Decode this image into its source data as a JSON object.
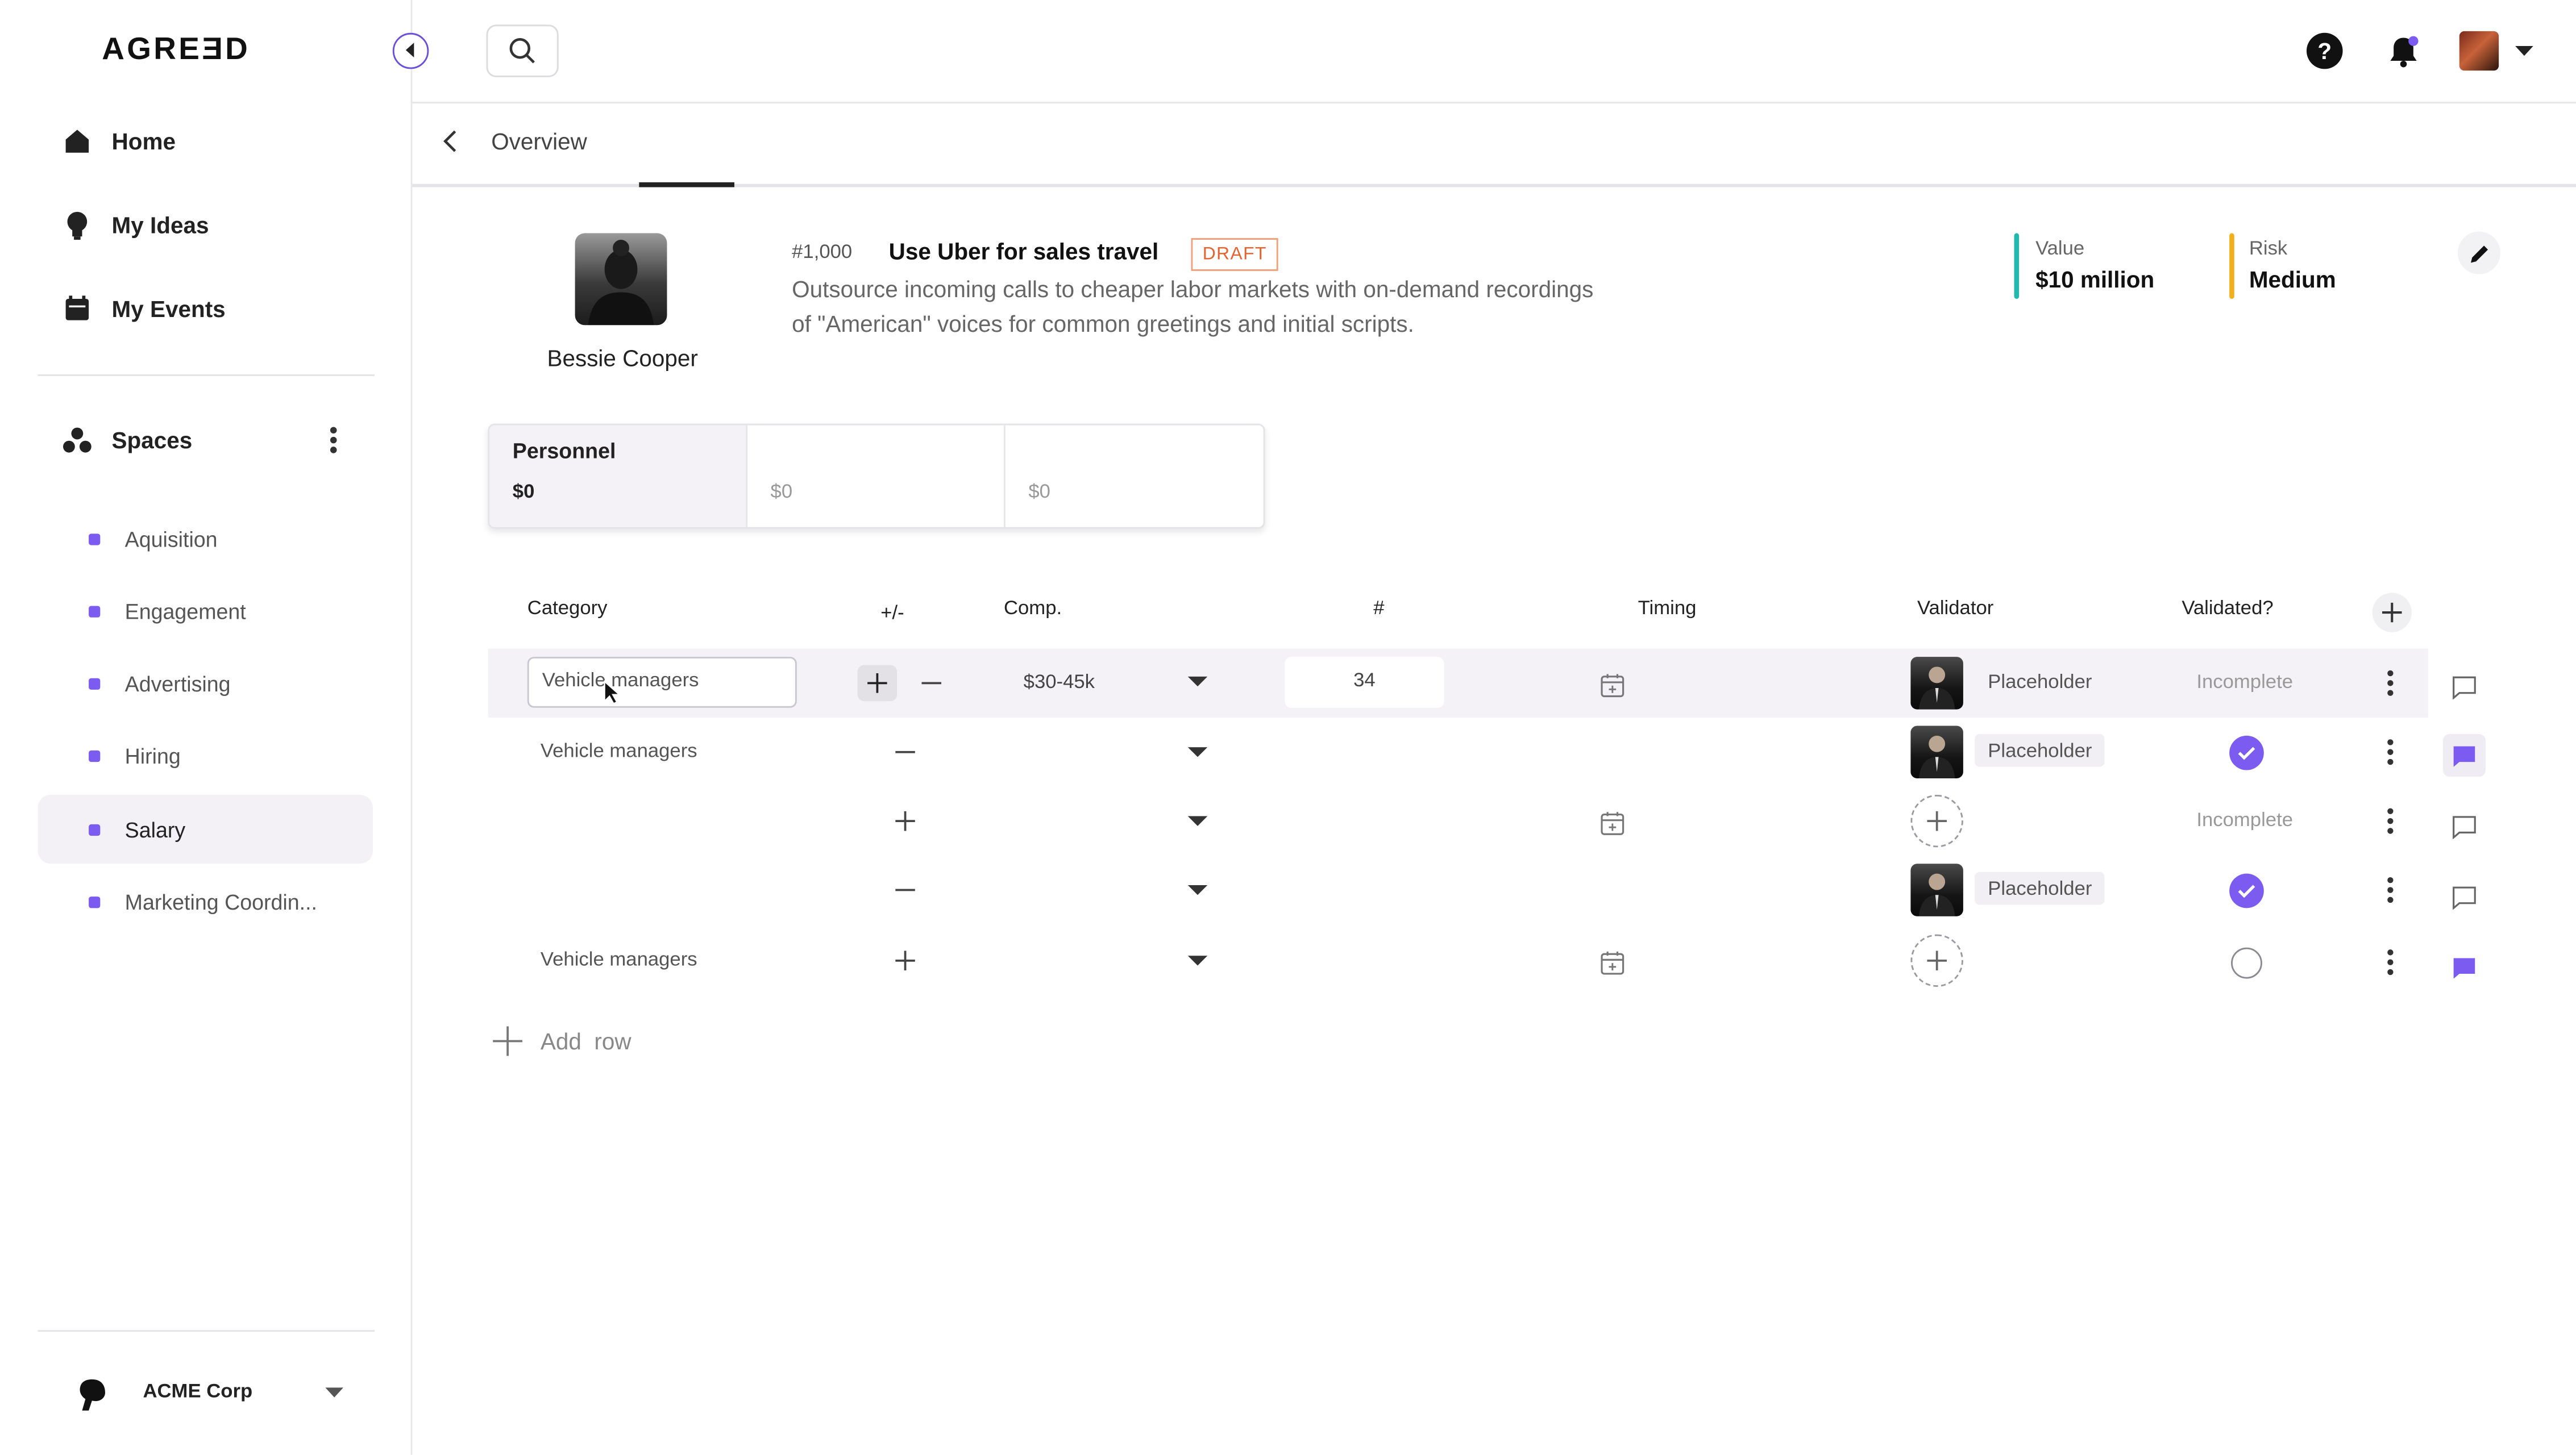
{
  "app": {
    "logo_text": "AGREƎD"
  },
  "sidebar": {
    "nav": [
      {
        "label": "Home",
        "icon": "home-icon"
      },
      {
        "label": "My Ideas",
        "icon": "lightbulb-icon"
      },
      {
        "label": "My Events",
        "icon": "calendar-icon"
      }
    ],
    "spaces_label": "Spaces",
    "spaces": [
      {
        "label": "Aquisition"
      },
      {
        "label": "Engagement"
      },
      {
        "label": "Advertising"
      },
      {
        "label": "Hiring"
      },
      {
        "label": "Salary",
        "active": true
      },
      {
        "label": "Marketing Coordin..."
      }
    ],
    "org_name": "ACME Corp"
  },
  "breadcrumb": {
    "label": "Overview"
  },
  "idea": {
    "owner_name": "Bessie Cooper",
    "number": "#1,000",
    "title": "Use Uber for sales travel",
    "status": "DRAFT",
    "description_line1": "Outsource incoming calls to cheaper labor markets with on-demand recordings",
    "description_line2": "of \"American\" voices for common greetings and initial scripts.",
    "value_label": "Value",
    "value": "$10 million",
    "risk_label": "Risk",
    "risk": "Medium"
  },
  "summary_cards": [
    {
      "title": "Personnel",
      "amount": "$0",
      "active": true
    },
    {
      "title": "",
      "amount": "$0"
    },
    {
      "title": "",
      "amount": "$0"
    }
  ],
  "table": {
    "headers": {
      "category": "Category",
      "plusminus": "+/-",
      "comp": "Comp.",
      "count": "#",
      "timing": "Timing",
      "validator": "Validator",
      "validated": "Validated?"
    },
    "rows": [
      {
        "category": "Vehicle managers",
        "comp": "$30-45k",
        "count": "34",
        "validator": "Placeholder",
        "status": "Incomplete"
      },
      {
        "category": "Vehicle managers",
        "validator": "Placeholder"
      },
      {
        "status": "Incomplete"
      },
      {
        "validator": "Placeholder"
      },
      {
        "category": "Vehicle managers"
      }
    ],
    "add_row_label": "Add  row"
  },
  "colors": {
    "accent": "#7c5cf0",
    "value_bar": "#21b8b0",
    "risk_bar": "#f2b01e",
    "draft": "#e7622e"
  }
}
